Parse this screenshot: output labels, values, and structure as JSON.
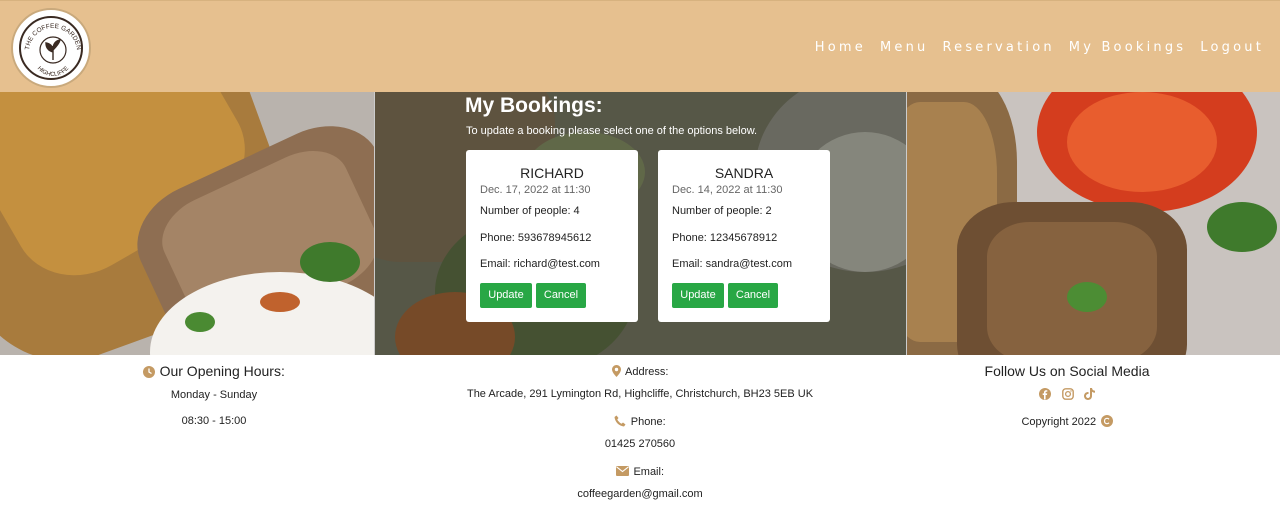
{
  "brand": {
    "logo_text_top": "THE COFFEE GARDEN",
    "logo_text_bottom": "HIGHCLIFFE"
  },
  "nav": {
    "items": [
      "Home",
      "Menu",
      "Reservation",
      "My Bookings",
      "Logout"
    ]
  },
  "bookings": {
    "title": "My Bookings:",
    "subtitle": "To update a booking please select one of the options below.",
    "cards": [
      {
        "name": "RICHARD",
        "date": "Dec. 17, 2022 at 11:30",
        "people": "Number of people: 4",
        "phone": "Phone: 593678945612",
        "email": "Email: richard@test.com",
        "update_label": "Update",
        "cancel_label": "Cancel"
      },
      {
        "name": "SANDRA",
        "date": "Dec. 14, 2022 at 11:30",
        "people": "Number of people: 2",
        "phone": "Phone: 12345678912",
        "email": "Email: sandra@test.com",
        "update_label": "Update",
        "cancel_label": "Cancel"
      }
    ]
  },
  "footer": {
    "hours": {
      "title": "Our Opening Hours:",
      "days": "Monday - Sunday",
      "time": "08:30 - 15:00"
    },
    "contact": {
      "address_label": "Address:",
      "address": "The Arcade, 291 Lymington Rd, Highcliffe, Christchurch, BH23 5EB UK",
      "phone_label": "Phone:",
      "phone": "01425 270560",
      "email_label": "Email:",
      "email": "coffeegarden@gmail.com"
    },
    "social": {
      "title": "Follow Us on Social Media",
      "copyright": "Copyright 2022"
    }
  },
  "colors": {
    "header_bg": "#e6c08f",
    "accent_brown": "#c49a63",
    "button_green": "#28a745"
  },
  "icons": [
    "clock-icon",
    "map-marker-icon",
    "phone-icon",
    "envelope-icon",
    "facebook-icon",
    "instagram-icon",
    "tiktok-icon",
    "copyright-icon"
  ]
}
